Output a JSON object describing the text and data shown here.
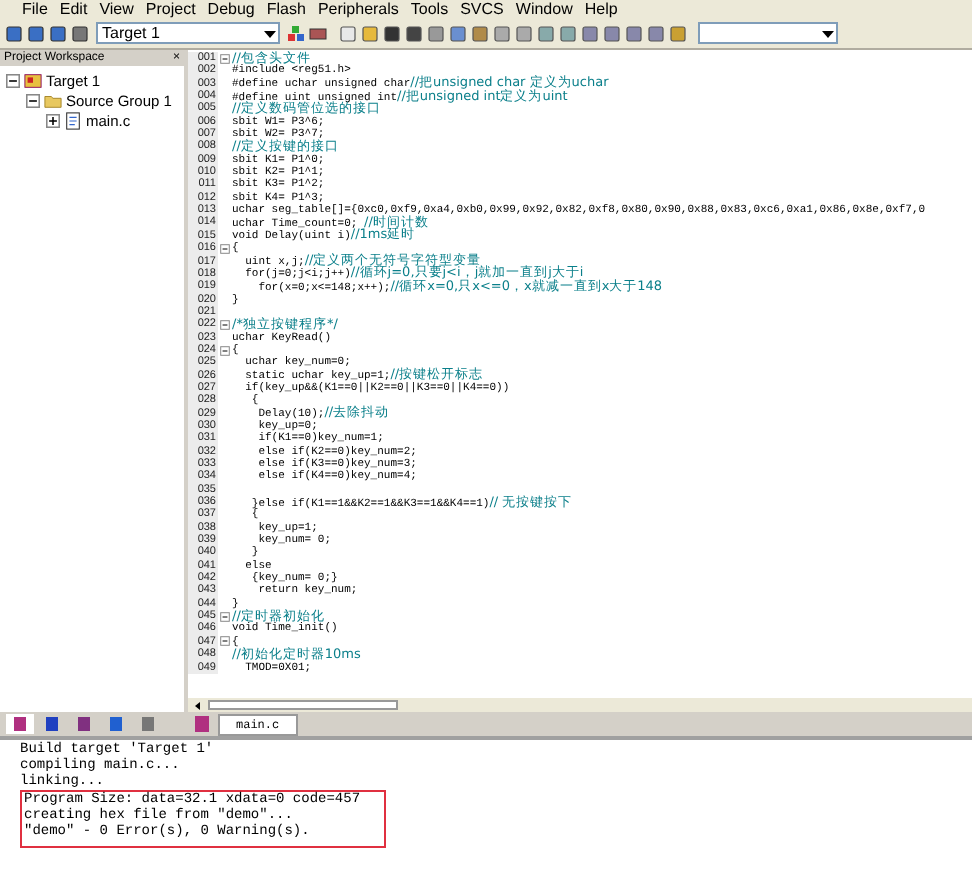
{
  "menu": [
    "File",
    "Edit",
    "View",
    "Project",
    "Debug",
    "Flash",
    "Peripherals",
    "Tools",
    "SVCS",
    "Window",
    "Help"
  ],
  "toolbar": {
    "target": "Target 1"
  },
  "workspace": {
    "title": "Project Workspace",
    "close": "×",
    "tree": [
      {
        "label": "Target 1",
        "kind": "target",
        "expanded": true,
        "children": [
          {
            "label": "Source Group 1",
            "kind": "group",
            "expanded": true,
            "children": [
              {
                "label": "main.c",
                "kind": "file",
                "expanded": false
              }
            ]
          }
        ]
      }
    ]
  },
  "editor": {
    "tabs": [
      {
        "label": "main.c",
        "selected": true
      }
    ],
    "lines": [
      {
        "num": "001",
        "fold": true,
        "comment": "//包含头文件"
      },
      {
        "num": "002",
        "fold": false,
        "code": "#include <reg51.h>"
      },
      {
        "num": "003",
        "fold": false,
        "code": "#define uchar unsigned char",
        "comment": "//把unsigned char 定义为uchar"
      },
      {
        "num": "004",
        "fold": false,
        "code": "#define uint unsigned int",
        "comment": "//把unsigned int定义为uint"
      },
      {
        "num": "005",
        "fold": false,
        "comment": "//定义数码管位选的接口"
      },
      {
        "num": "006",
        "fold": false,
        "code": "sbit W1= P3^6;"
      },
      {
        "num": "007",
        "fold": false,
        "code": "sbit W2= P3^7;"
      },
      {
        "num": "008",
        "fold": false,
        "comment": "//定义按键的接口"
      },
      {
        "num": "009",
        "fold": false,
        "code": "sbit K1= P1^0;"
      },
      {
        "num": "010",
        "fold": false,
        "code": "sbit K2= P1^1;"
      },
      {
        "num": "011",
        "fold": false,
        "code": "sbit K3= P1^2;"
      },
      {
        "num": "012",
        "fold": false,
        "code": "sbit K4= P1^3;"
      },
      {
        "num": "013",
        "fold": false,
        "code": "uchar seg_table[]={0xc0,0xf9,0xa4,0xb0,0x99,0x92,0x82,0xf8,0x80,0x90,0x88,0x83,0xc6,0xa1,0x86,0x8e,0xf7,0"
      },
      {
        "num": "014",
        "fold": false,
        "code": "uchar Time_count=0; ",
        "comment": "//时间计数"
      },
      {
        "num": "015",
        "fold": false,
        "code": "void Delay(uint i)",
        "comment": "//1ms延时"
      },
      {
        "num": "016",
        "fold": true,
        "code": "{"
      },
      {
        "num": "017",
        "fold": false,
        "code": "  uint x,j;",
        "comment": "//定义两个无符号字符型变量"
      },
      {
        "num": "018",
        "fold": false,
        "code": "  for(j=0;j<i;j++)",
        "comment": "//循环j=0,只要j<i，j就加一直到j大于i"
      },
      {
        "num": "019",
        "fold": false,
        "code": "    for(x=0;x<=148;x++);",
        "comment": "//循环x=0,只x<=0，x就减一直到x大于148"
      },
      {
        "num": "020",
        "fold": false,
        "code": "}"
      },
      {
        "num": "021",
        "fold": false
      },
      {
        "num": "022",
        "fold": true,
        "comment": "/*独立按键程序*/"
      },
      {
        "num": "023",
        "fold": false,
        "code": "uchar KeyRead()"
      },
      {
        "num": "024",
        "fold": true,
        "code": "{"
      },
      {
        "num": "025",
        "fold": false,
        "code": "  uchar key_num=0;"
      },
      {
        "num": "026",
        "fold": false,
        "code": "  static uchar key_up=1;",
        "comment": "//按键松开标志"
      },
      {
        "num": "027",
        "fold": false,
        "code": "  if(key_up&&(K1==0||K2==0||K3==0||K4==0))"
      },
      {
        "num": "028",
        "fold": false,
        "code": "   {"
      },
      {
        "num": "029",
        "fold": false,
        "code": "    Delay(10);",
        "comment": "//去除抖动"
      },
      {
        "num": "030",
        "fold": false,
        "code": "    key_up=0;"
      },
      {
        "num": "031",
        "fold": false,
        "code": "    if(K1==0)key_num=1;"
      },
      {
        "num": "032",
        "fold": false,
        "code": "    else if(K2==0)key_num=2;"
      },
      {
        "num": "033",
        "fold": false,
        "code": "    else if(K3==0)key_num=3;"
      },
      {
        "num": "034",
        "fold": false,
        "code": "    else if(K4==0)key_num=4;"
      },
      {
        "num": "035",
        "fold": false
      },
      {
        "num": "036",
        "fold": false,
        "code": "   }else if(K1==1&&K2==1&&K3==1&&K4==1)",
        "comment": "// 无按键按下"
      },
      {
        "num": "037",
        "fold": false,
        "code": "   {"
      },
      {
        "num": "038",
        "fold": false,
        "code": "    key_up=1;"
      },
      {
        "num": "039",
        "fold": false,
        "code": "    key_num= 0;"
      },
      {
        "num": "040",
        "fold": false,
        "code": "   }"
      },
      {
        "num": "041",
        "fold": false,
        "code": "  else"
      },
      {
        "num": "042",
        "fold": false,
        "code": "   {key_num= 0;}"
      },
      {
        "num": "043",
        "fold": false,
        "code": "    return key_num;"
      },
      {
        "num": "044",
        "fold": false,
        "code": "}"
      },
      {
        "num": "045",
        "fold": true,
        "comment": "//定时器初始化"
      },
      {
        "num": "046",
        "fold": false,
        "code": "void Time_init()"
      },
      {
        "num": "047",
        "fold": true,
        "code": "{"
      },
      {
        "num": "048",
        "fold": false,
        "comment": "//初始化定时器10ms"
      },
      {
        "num": "049",
        "fold": false,
        "code": "  TMOD=0X01;"
      }
    ]
  },
  "output": [
    {
      "text": "Build target 'Target 1'",
      "highlighted": false
    },
    {
      "text": "compiling main.c...",
      "highlighted": false
    },
    {
      "text": "linking...",
      "highlighted": false
    },
    {
      "text": "Program Size: data=32.1 xdata=0 code=457",
      "highlighted": true
    },
    {
      "text": "creating hex file from \"demo\"...",
      "highlighted": true
    },
    {
      "text": "\"demo\" - 0 Error(s), 0 Warning(s).",
      "highlighted": true
    }
  ]
}
